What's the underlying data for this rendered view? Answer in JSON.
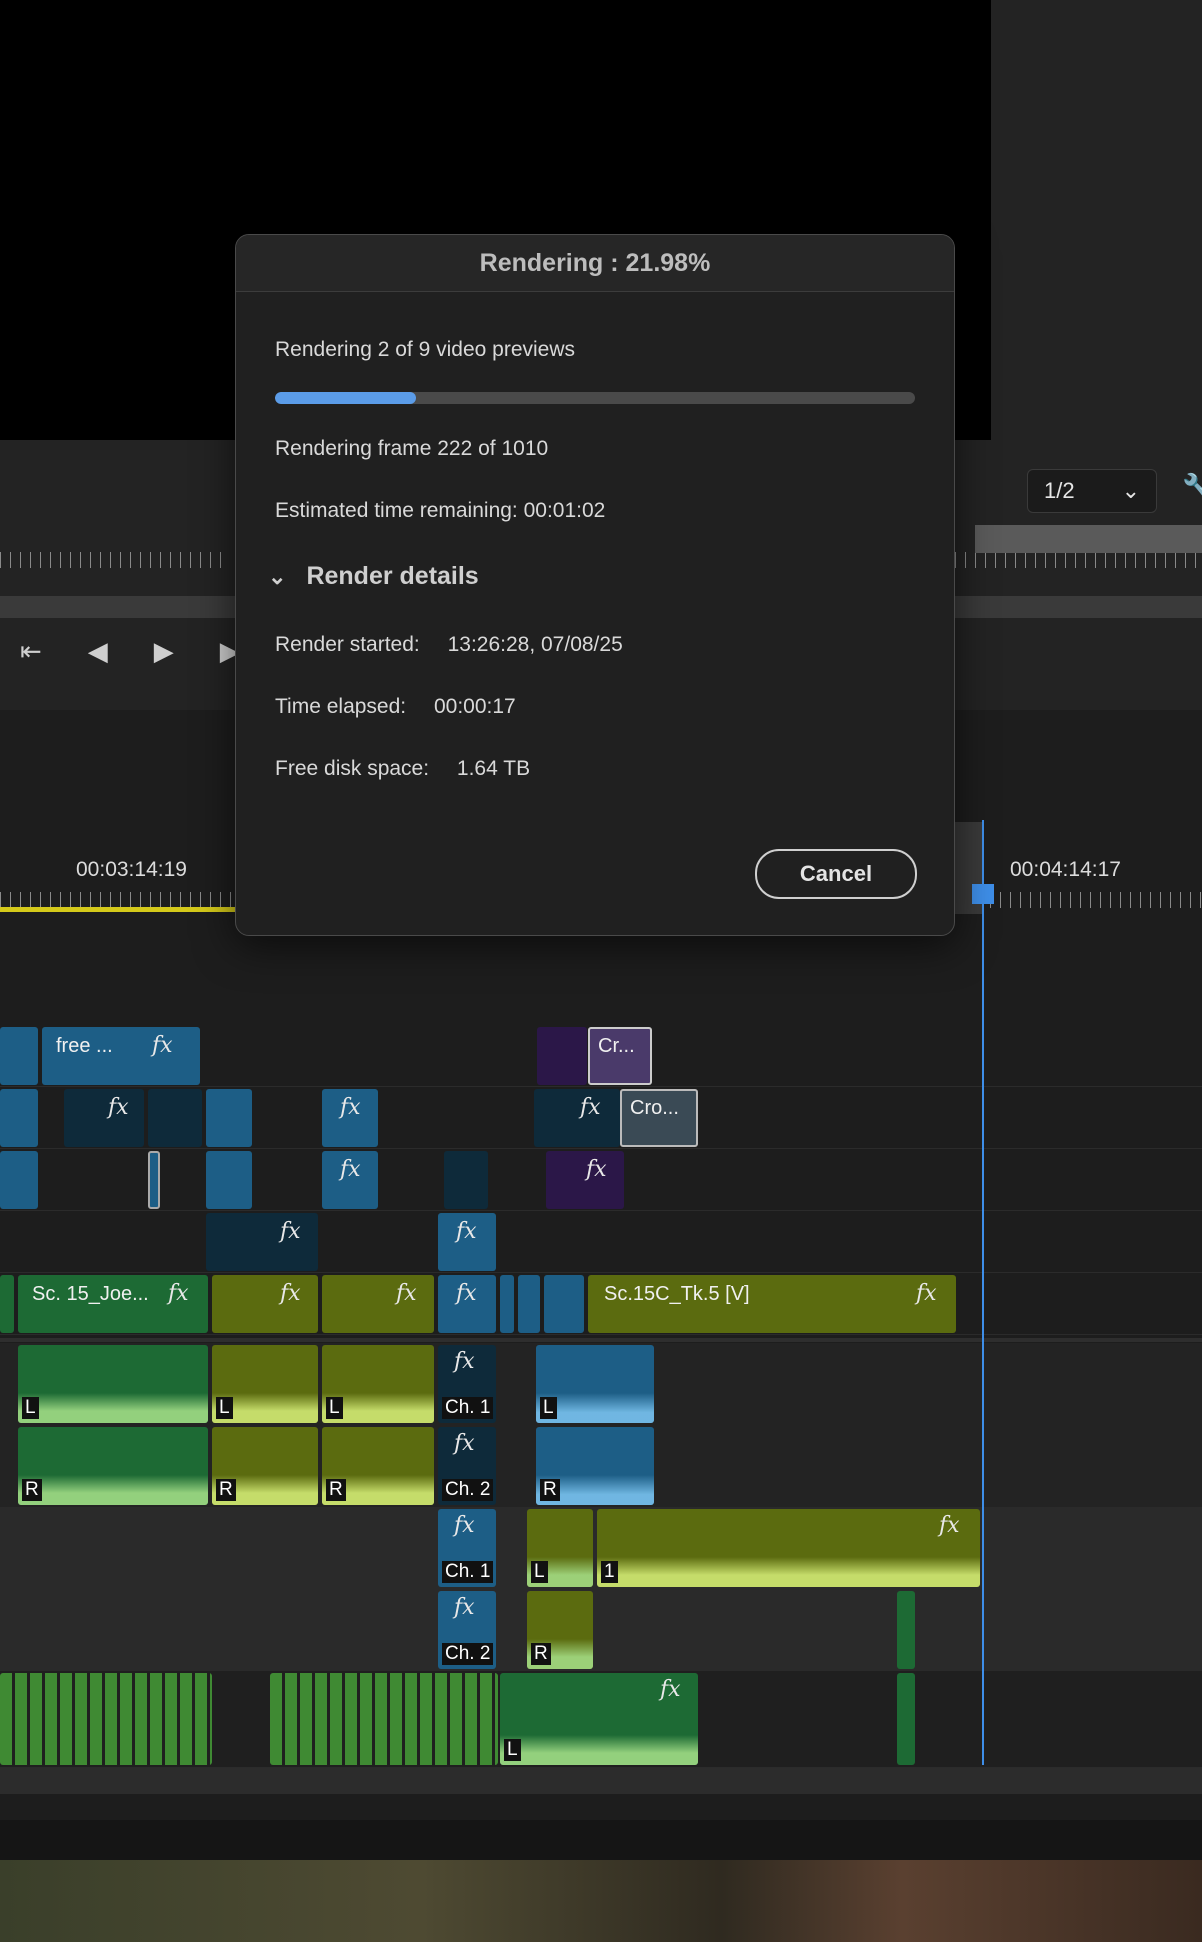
{
  "dialog": {
    "title": "Rendering : 21.98%",
    "previews_line": "Rendering 2 of 9 video previews",
    "progress": 0.2198,
    "frame_line": "Rendering frame 222 of 1010",
    "eta_line": "Estimated time remaining: 00:01:02",
    "details_toggle": "Render details",
    "render_started_label": "Render started:",
    "render_started_value": "13:26:28, 07/08/25",
    "time_elapsed_label": "Time elapsed:",
    "time_elapsed_value": "00:00:17",
    "free_disk_label": "Free disk space:",
    "free_disk_value": "1.64 TB",
    "cancel_label": "Cancel"
  },
  "program_monitor": {
    "zoom_value": "1/2"
  },
  "transport": {
    "icons": [
      "go-to-in-icon",
      "step-back-icon",
      "play-icon",
      "step-forward-icon"
    ]
  },
  "timeline": {
    "timecode_left": "00:03:14:19",
    "timecode_right": "00:04:14:17",
    "clips": {
      "free": "free ...",
      "cr": "Cr...",
      "cro": "Cro...",
      "sc15": "Sc. 15_Joe...",
      "sc15c": "Sc.15C_Tk.5 [V]",
      "ch1": "Ch. 1",
      "ch2": "Ch. 2",
      "L": "L",
      "R": "R",
      "one": "1",
      "fx": "fx"
    }
  },
  "colors": {
    "accent": "#5b9ce8",
    "playhead": "#3e8ee8",
    "video_clip_blue": "#1d5e86",
    "audio_green": "#1d6a34",
    "audio_olive": "#5b6b0f",
    "render_bar_yellow": "#d4c91a"
  }
}
